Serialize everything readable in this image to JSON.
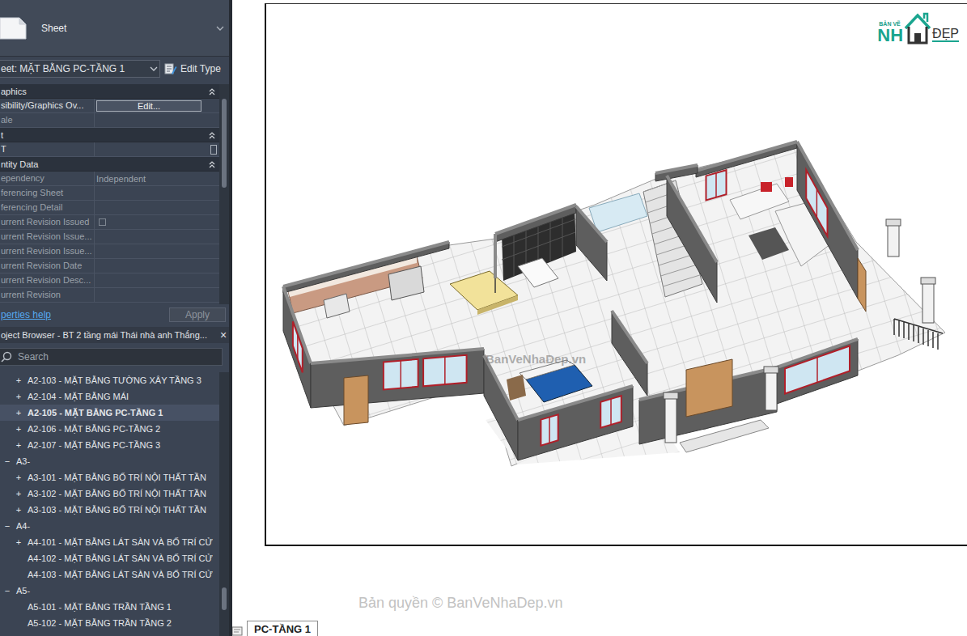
{
  "properties": {
    "type_name": "Sheet",
    "instance_selector": "eet: MẶT BẰNG PC-TẦNG 1",
    "edit_type": "Edit Type",
    "sections": [
      {
        "title": "aphics",
        "expanded": true,
        "rows": [
          {
            "label": "sibility/Graphics Ov...",
            "value": "Edit...",
            "kind": "button",
            "disabled": false
          },
          {
            "label": "ale",
            "kind": "text",
            "disabled": true
          }
        ]
      },
      {
        "title": "t",
        "expanded": true,
        "rows": [
          {
            "label": "T",
            "kind": "edit-box",
            "disabled": false
          }
        ]
      },
      {
        "title": "ntity Data",
        "expanded": true,
        "rows": [
          {
            "label": "ependency",
            "value": "Independent",
            "kind": "text",
            "disabled": true
          },
          {
            "label": "ferencing Sheet",
            "kind": "text",
            "disabled": true
          },
          {
            "label": "ferencing Detail",
            "kind": "text",
            "disabled": true
          },
          {
            "label": "urrent Revision Issued",
            "kind": "checkbox",
            "checked": false,
            "disabled": true
          },
          {
            "label": "urrent Revision Issue...",
            "kind": "text",
            "disabled": true
          },
          {
            "label": "urrent Revision Issue...",
            "kind": "text",
            "disabled": true
          },
          {
            "label": "urrent Revision Date",
            "kind": "text",
            "disabled": true
          },
          {
            "label": "urrent Revision Desc...",
            "kind": "text",
            "disabled": true
          },
          {
            "label": "urrent Revision",
            "kind": "text",
            "disabled": true
          }
        ]
      }
    ],
    "help_link": "perties help",
    "apply": {
      "label": "Apply",
      "disabled": true
    }
  },
  "project_browser": {
    "title": "oject Browser - BT 2 tầng mái Thái nhà anh Thắng...",
    "close": "×",
    "search": {
      "placeholder": "Search"
    },
    "items": [
      {
        "toggle": "+",
        "label": "A2-103 - MẶT BẰNG TƯỜNG XÂY TẦNG 3",
        "level": 2,
        "selected": false
      },
      {
        "toggle": "+",
        "label": "A2-104 - MẶT BẰNG MÁI",
        "level": 2,
        "selected": false
      },
      {
        "toggle": "+",
        "label": "A2-105 - MẶT BẰNG PC-TẦNG 1",
        "level": 2,
        "selected": true
      },
      {
        "toggle": "+",
        "label": "A2-106 - MẶT BẰNG PC-TẦNG 2",
        "level": 2,
        "selected": false
      },
      {
        "toggle": "+",
        "label": "A2-107 - MẶT BẰNG PC-TẦNG 3",
        "level": 2,
        "selected": false
      },
      {
        "toggle": "−",
        "label": "A3-",
        "level": 1,
        "selected": false
      },
      {
        "toggle": "+",
        "label": "A3-101 - MẶT BẰNG BỐ TRÍ NỘI THẤT TẦN",
        "level": 2,
        "selected": false
      },
      {
        "toggle": "+",
        "label": "A3-102 - MẶT BẰNG BỐ TRÍ NỘI THẤT TẦN",
        "level": 2,
        "selected": false
      },
      {
        "toggle": "+",
        "label": "A3-103 - MẶT BẰNG BỐ TRÍ NỘI THẤT TẦN",
        "level": 2,
        "selected": false
      },
      {
        "toggle": "−",
        "label": "A4-",
        "level": 1,
        "selected": false
      },
      {
        "toggle": "+",
        "label": "A4-101 - MẶT BẰNG LÁT SÀN VÀ BỐ TRÍ CỬ",
        "level": 2,
        "selected": false
      },
      {
        "label": "A4-102 - MẶT BẰNG LÁT SÀN VÀ BỐ TRÍ CỬ",
        "level": 2,
        "selected": false
      },
      {
        "label": "A4-103 - MẶT BẰNG LÁT SÀN VÀ BỐ TRÍ CỬ",
        "level": 2,
        "selected": false
      },
      {
        "toggle": "−",
        "label": "A5-",
        "level": 1,
        "selected": false
      },
      {
        "label": "A5-101 - MẶT BẰNG TRẦN TẦNG 1",
        "level": 2,
        "selected": false
      },
      {
        "label": "A5-102 - MẶT BẰNG TRẦN TẦNG 2",
        "level": 2,
        "selected": false
      }
    ]
  },
  "view": {
    "logo": {
      "small": "BẢN VẼ",
      "main": "NH",
      "accent": "ĐẸP"
    },
    "watermark": "BanVeNhaDep.vn",
    "copyright": "Bản quyền © BanVeNhaDep.vn",
    "tabs": [
      {
        "label": "PC-TẦNG 1",
        "selected": true
      }
    ]
  }
}
